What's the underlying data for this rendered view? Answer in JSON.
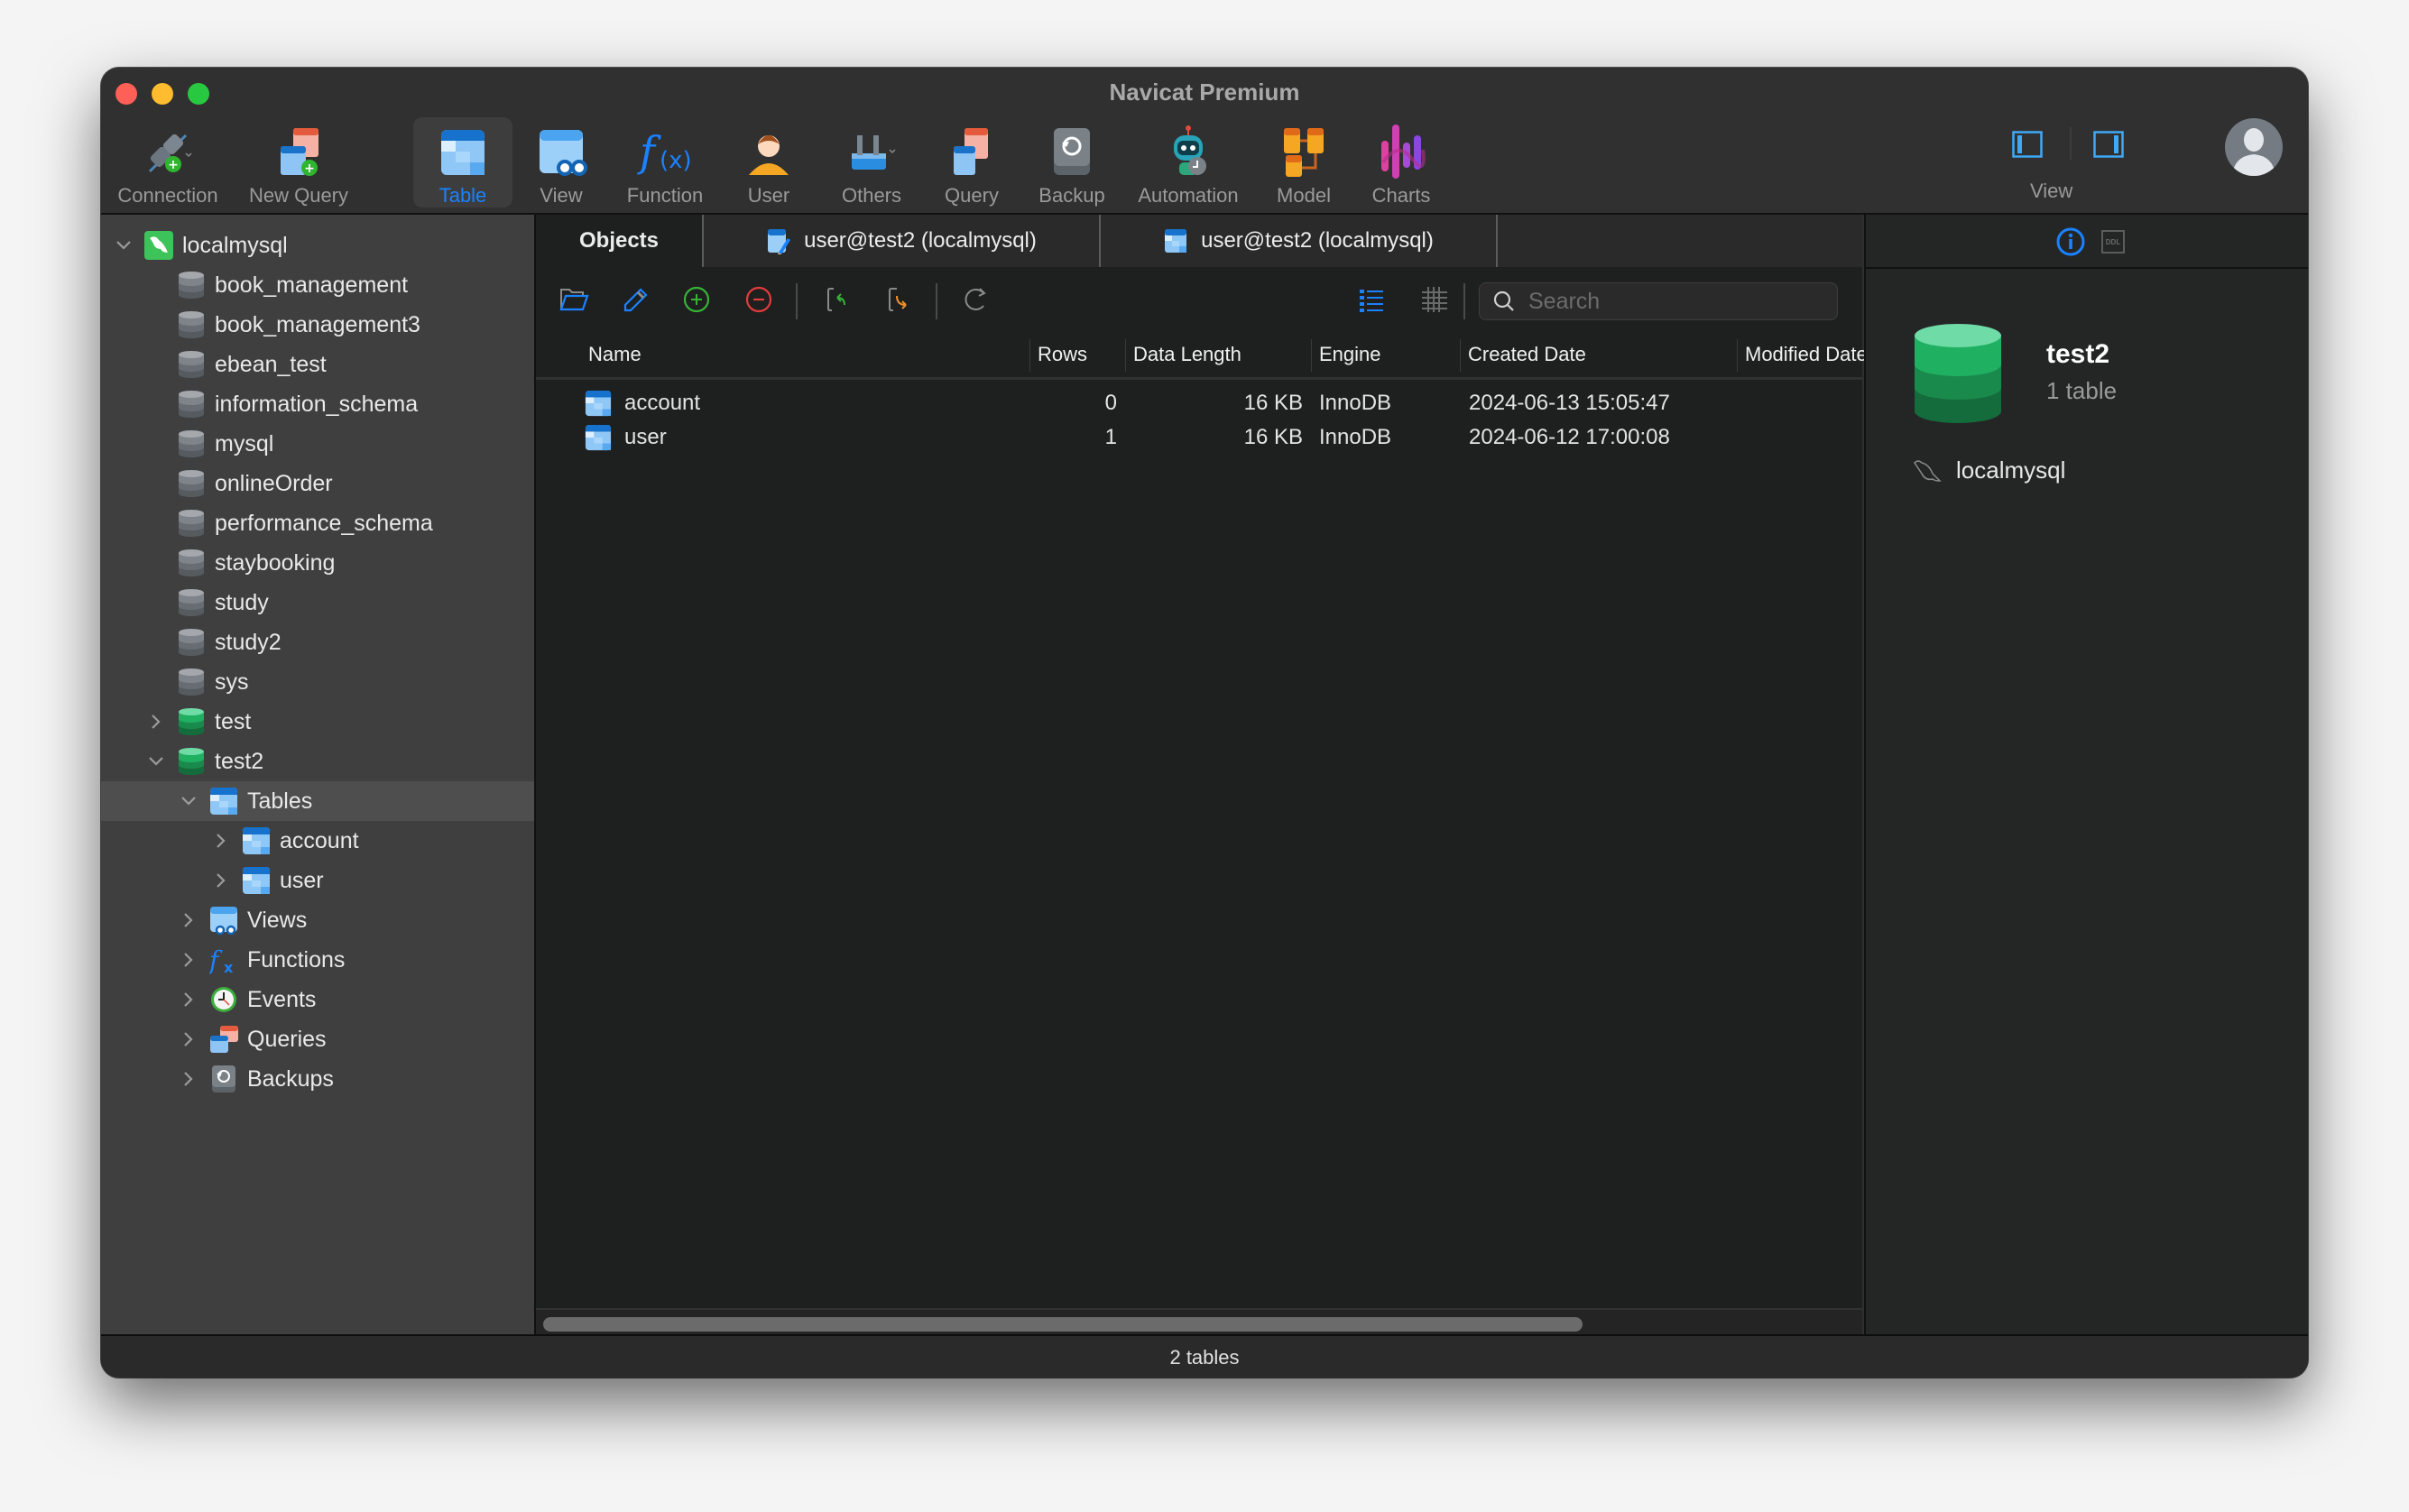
{
  "window": {
    "title": "Navicat Premium"
  },
  "toolbar": {
    "items": [
      {
        "label": "Connection",
        "icon": "connection-plug-icon"
      },
      {
        "label": "New Query",
        "icon": "new-query-icon"
      },
      {
        "label": "Table",
        "icon": "table-icon",
        "active": true
      },
      {
        "label": "View",
        "icon": "view-icon"
      },
      {
        "label": "Function",
        "icon": "function-icon"
      },
      {
        "label": "User",
        "icon": "user-icon"
      },
      {
        "label": "Others",
        "icon": "others-tools-icon"
      },
      {
        "label": "Query",
        "icon": "query-icon"
      },
      {
        "label": "Backup",
        "icon": "backup-icon"
      },
      {
        "label": "Automation",
        "icon": "automation-robot-icon"
      },
      {
        "label": "Model",
        "icon": "model-icon"
      },
      {
        "label": "Charts",
        "icon": "charts-icon"
      }
    ],
    "view_label": "View",
    "accent_color": "#1a82ff"
  },
  "sidebar": {
    "connection": "localmysql",
    "databases": [
      "book_management",
      "book_management3",
      "ebean_test",
      "information_schema",
      "mysql",
      "onlineOrder",
      "performance_schema",
      "staybooking",
      "study",
      "study2",
      "sys",
      "test",
      "test2"
    ],
    "test2_children": {
      "tables_label": "Tables",
      "tables": [
        "account",
        "user"
      ],
      "views_label": "Views",
      "functions_label": "Functions",
      "events_label": "Events",
      "queries_label": "Queries",
      "backups_label": "Backups"
    },
    "search_placeholder": "Search"
  },
  "tabs": [
    {
      "label": "Objects",
      "active": true
    },
    {
      "label": "user@test2 (localmysql)",
      "icon": "table-design-icon"
    },
    {
      "label": "user@test2 (localmysql)",
      "icon": "table-icon"
    }
  ],
  "objects": {
    "search_placeholder": "Search",
    "columns": [
      "Name",
      "Rows",
      "Data Length",
      "Engine",
      "Created Date",
      "Modified Date"
    ],
    "rows": [
      {
        "name": "account",
        "rows": "0",
        "data_length": "16 KB",
        "engine": "InnoDB",
        "created": "2024-06-13 15:05:47",
        "modified": ""
      },
      {
        "name": "user",
        "rows": "1",
        "data_length": "16 KB",
        "engine": "InnoDB",
        "created": "2024-06-12 17:00:08",
        "modified": ""
      }
    ]
  },
  "inspector": {
    "title": "test2",
    "subtitle": "1 table",
    "connection": "localmysql",
    "ddl_label": "DDL"
  },
  "status": {
    "text": "2 tables"
  }
}
